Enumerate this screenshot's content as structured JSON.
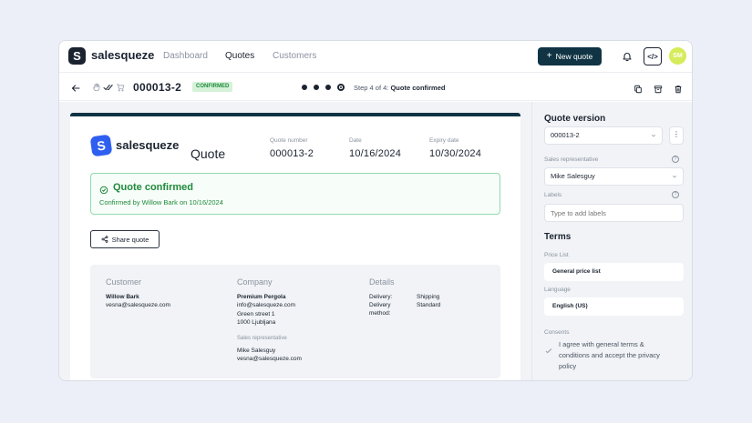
{
  "app": {
    "brand": "salesqueze",
    "logo_letter": "S",
    "nav": [
      {
        "label": "Dashboard",
        "active": false
      },
      {
        "label": "Quotes",
        "active": true
      },
      {
        "label": "Customers",
        "active": false
      }
    ],
    "new_quote_label": "New quote",
    "code_label": "</>",
    "avatar_initials": "SM"
  },
  "subheader": {
    "quote_number": "000013-2",
    "status": "CONFIRMED",
    "step_label": "Step 4 of 4:",
    "step_name": "Quote confirmed",
    "steps_total": 4,
    "steps_current": 4
  },
  "document": {
    "brand": "salesqueze",
    "title": "Quote",
    "meta": [
      {
        "label": "Quote number",
        "value": "000013-2"
      },
      {
        "label": "Date",
        "value": "10/16/2024"
      },
      {
        "label": "Expiry date",
        "value": "10/30/2024"
      }
    ],
    "confirm_title": "Quote confirmed",
    "confirm_sub": "Confirmed by Willow Bark on 10/16/2024",
    "share_label": "Share quote",
    "customer": {
      "heading": "Customer",
      "name": "Willow Bark",
      "email": "vesna@salesqueze.com"
    },
    "company": {
      "heading": "Company",
      "name": "Premium Pergola",
      "email": "info@salesqueze.com",
      "street": "Green street 1",
      "city": "1000 Ljubljana",
      "rep_label": "Sales representative",
      "rep_name": "Mike Salesguy",
      "rep_email": "vesna@salesqueze.com"
    },
    "details": {
      "heading": "Details",
      "delivery_key": "Delivery:",
      "delivery_val": "Shipping",
      "method_key1": "Delivery",
      "method_key2": "method:",
      "method_val": "Standard"
    }
  },
  "panel": {
    "version_title": "Quote version",
    "version_value": "000013-2",
    "menu_label": "⋮",
    "rep_label": "Sales representative",
    "rep_value": "Mike Salesguy",
    "labels_label": "Labels",
    "labels_placeholder": "Type to add labels",
    "help": "?",
    "terms_title": "Terms",
    "price_list_label": "Price List",
    "price_list_value": "General price list",
    "language_label": "Language",
    "language_value": "English (US)",
    "consents_label": "Consents",
    "consent_text": "I agree with general terms & conditions and accept the privacy policy"
  },
  "colors": {
    "primary": "#103444",
    "confirmed_green": "#1f8a3a",
    "confirmed_bg": "#d4f2d8",
    "doc_logo_blue": "#2f5ff0",
    "avatar": "#d7ec5a"
  },
  "icons": [
    "logo-icon",
    "bell-icon",
    "code-icon",
    "back-arrow-icon",
    "hand-icon",
    "check-double-icon",
    "cart-icon",
    "copy-icon",
    "archive-icon",
    "trash-icon",
    "check-circle-icon",
    "share-icon",
    "chevron-down-icon",
    "help-icon",
    "check-icon",
    "plus-icon"
  ]
}
